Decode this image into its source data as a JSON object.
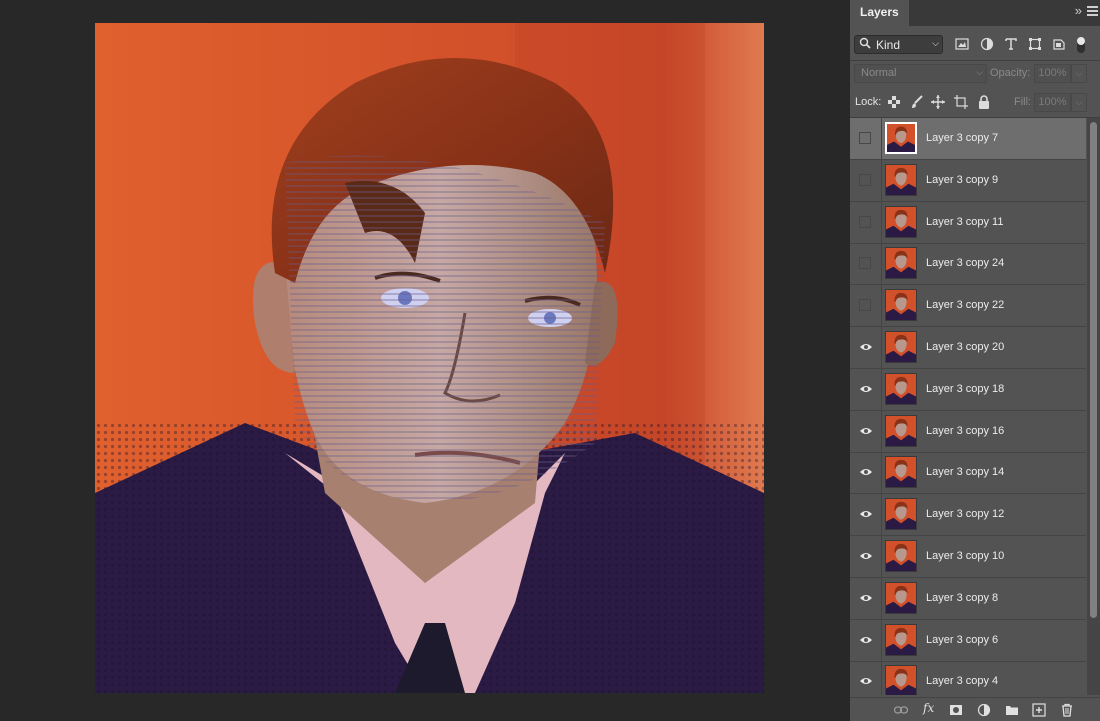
{
  "panel": {
    "tab_label": "Layers",
    "collapse_glyph": "»",
    "filter": {
      "kind_label": "Kind",
      "icons": [
        "pixel-filter-icon",
        "adjustment-filter-icon",
        "type-filter-icon",
        "shape-filter-icon",
        "smart-object-filter-icon"
      ]
    },
    "blend_mode": "Normal",
    "opacity_label": "Opacity:",
    "opacity_value": "100%",
    "lock_label": "Lock:",
    "fill_label": "Fill:",
    "fill_value": "100%",
    "layers": [
      {
        "name": "Layer 3 copy 7",
        "visible": false,
        "selected": true
      },
      {
        "name": "Layer 3 copy 9",
        "visible": false,
        "selected": false
      },
      {
        "name": "Layer 3 copy 11",
        "visible": false,
        "selected": false
      },
      {
        "name": "Layer 3 copy 24",
        "visible": false,
        "selected": false
      },
      {
        "name": "Layer 3 copy 22",
        "visible": false,
        "selected": false
      },
      {
        "name": "Layer 3 copy 20",
        "visible": true,
        "selected": false
      },
      {
        "name": "Layer 3 copy 18",
        "visible": true,
        "selected": false
      },
      {
        "name": "Layer 3 copy 16",
        "visible": true,
        "selected": false
      },
      {
        "name": "Layer 3 copy 14",
        "visible": true,
        "selected": false
      },
      {
        "name": "Layer 3 copy 12",
        "visible": true,
        "selected": false
      },
      {
        "name": "Layer 3 copy 10",
        "visible": true,
        "selected": false
      },
      {
        "name": "Layer 3 copy 8",
        "visible": true,
        "selected": false
      },
      {
        "name": "Layer 3 copy 6",
        "visible": true,
        "selected": false
      },
      {
        "name": "Layer 3 copy 4",
        "visible": true,
        "selected": false
      }
    ],
    "bottom_tools": [
      "link-layers-icon",
      "fx-icon",
      "add-mask-icon",
      "adjustment-layer-icon",
      "new-group-icon",
      "new-layer-icon",
      "delete-layer-icon"
    ]
  },
  "colors": {
    "panel_bg": "#535353",
    "selected_row": "#6e6e6e",
    "canvas_bg": "#282828",
    "artwork_background": "#d2502a"
  }
}
